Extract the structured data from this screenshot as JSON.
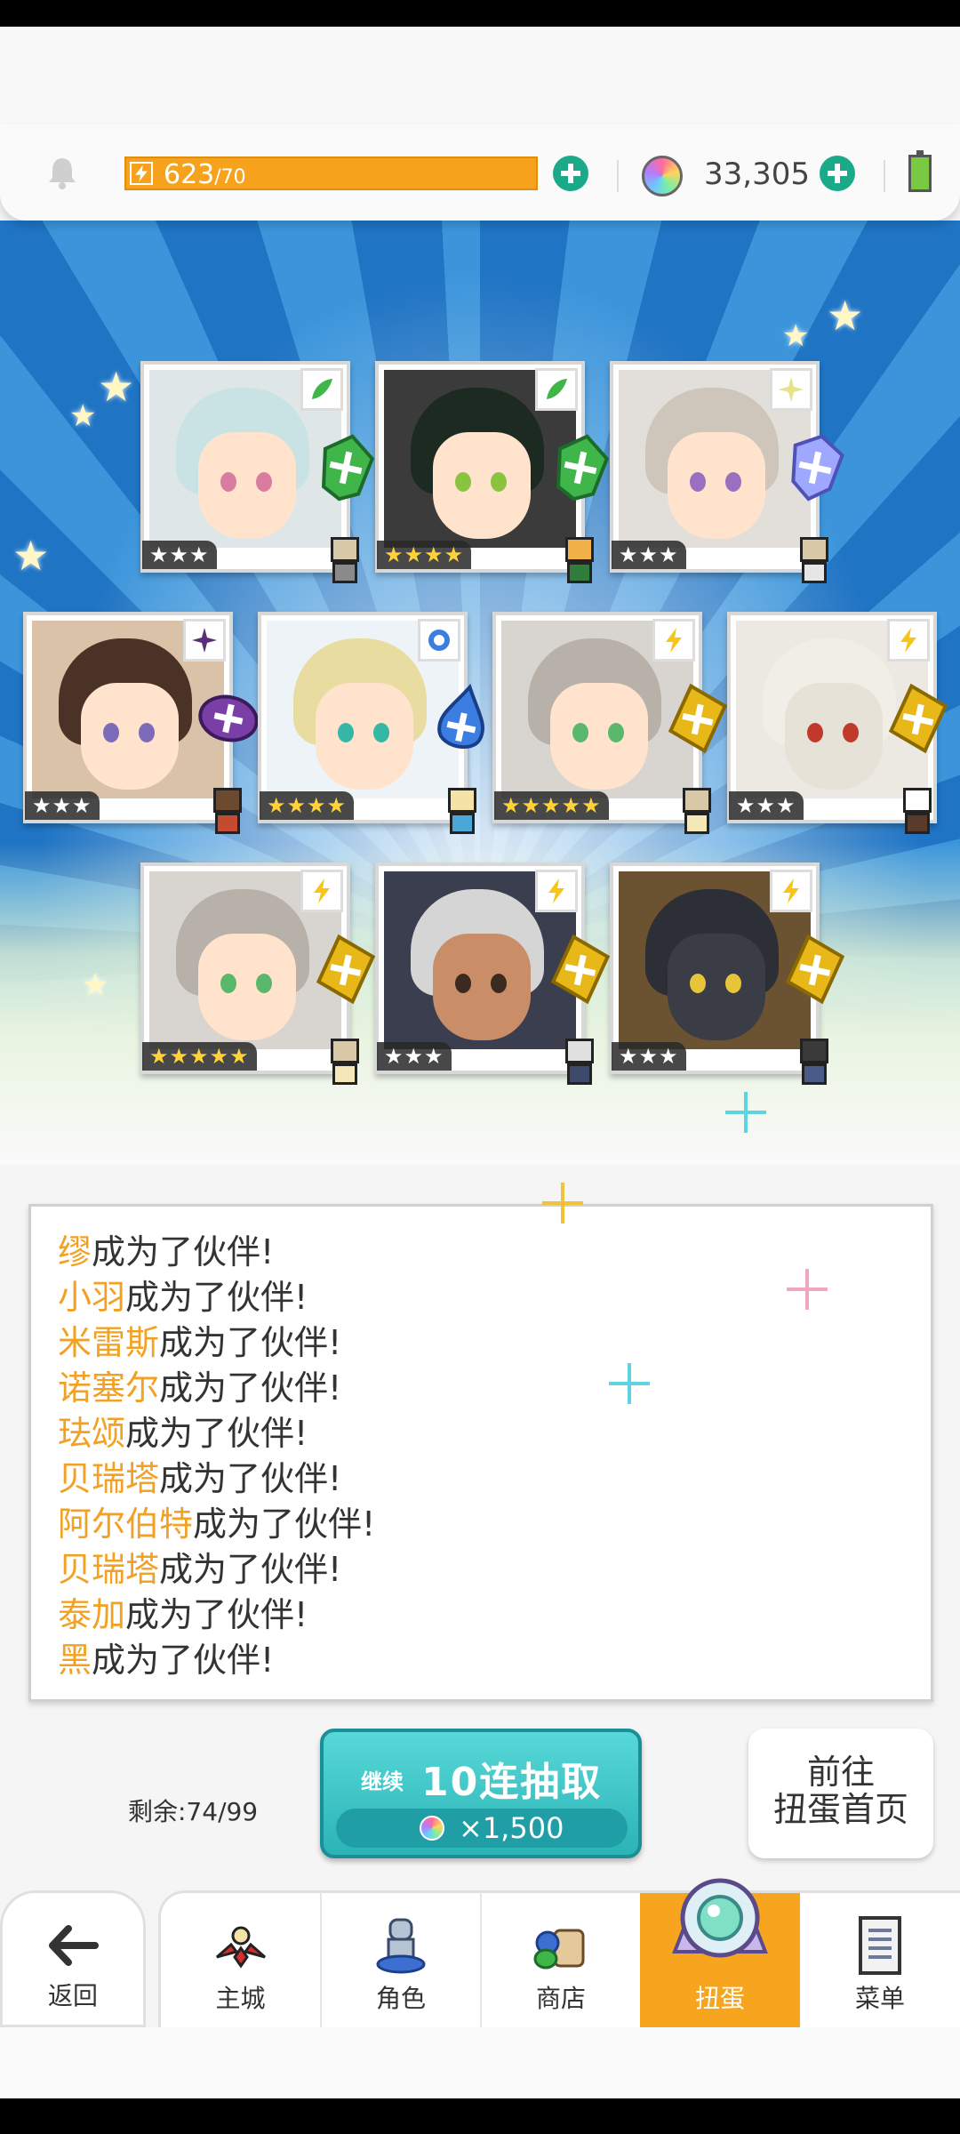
{
  "resources": {
    "energy_current": "623",
    "energy_max": "/70",
    "gems": "33,305"
  },
  "cards": [
    {
      "stars": "★★★",
      "element": "leaf"
    },
    {
      "stars": "★★★★",
      "element": "leaf"
    },
    {
      "stars": "★★★",
      "element": "light"
    },
    {
      "stars": "★★★",
      "element": "dark"
    },
    {
      "stars": "★★★★",
      "element": "water"
    },
    {
      "stars": "★★★★★",
      "element": "thunder"
    },
    {
      "stars": "★★★",
      "element": "thunder"
    },
    {
      "stars": "★★★★★",
      "element": "thunder"
    },
    {
      "stars": "★★★",
      "element": "thunder"
    },
    {
      "stars": "★★★",
      "element": "thunder"
    }
  ],
  "messages": [
    {
      "name": "缪",
      "suffix": "成为了伙伴!"
    },
    {
      "name": "小羽",
      "suffix": "成为了伙伴!"
    },
    {
      "name": "米雷斯",
      "suffix": "成为了伙伴!"
    },
    {
      "name": "诺塞尔",
      "suffix": "成为了伙伴!"
    },
    {
      "name": "珐颂",
      "suffix": "成为了伙伴!"
    },
    {
      "name": "贝瑞塔",
      "suffix": "成为了伙伴!"
    },
    {
      "name": "阿尔伯特",
      "suffix": "成为了伙伴!"
    },
    {
      "name": "贝瑞塔",
      "suffix": "成为了伙伴!"
    },
    {
      "name": "泰加",
      "suffix": "成为了伙伴!"
    },
    {
      "name": "黑",
      "suffix": "成为了伙伴!"
    }
  ],
  "gacha": {
    "remaining": "剩余:74/99",
    "continue_label": "继续",
    "pull_label": "10连抽取",
    "cost": "×1,500",
    "goto_line1": "前往",
    "goto_line2": "扭蛋首页"
  },
  "nav": {
    "back": "返回",
    "city": "主城",
    "character": "角色",
    "shop": "商店",
    "gacha": "扭蛋",
    "menu": "菜单"
  },
  "colors": {
    "accent_orange": "#f7a51f",
    "name_highlight": "#f2a122",
    "teal_button": "#2bb3b6",
    "leaf": "#3fb54a",
    "thunder": "#f5c518",
    "water": "#3b7de0",
    "dark": "#7a3fa6",
    "light": "#e6e28a"
  }
}
